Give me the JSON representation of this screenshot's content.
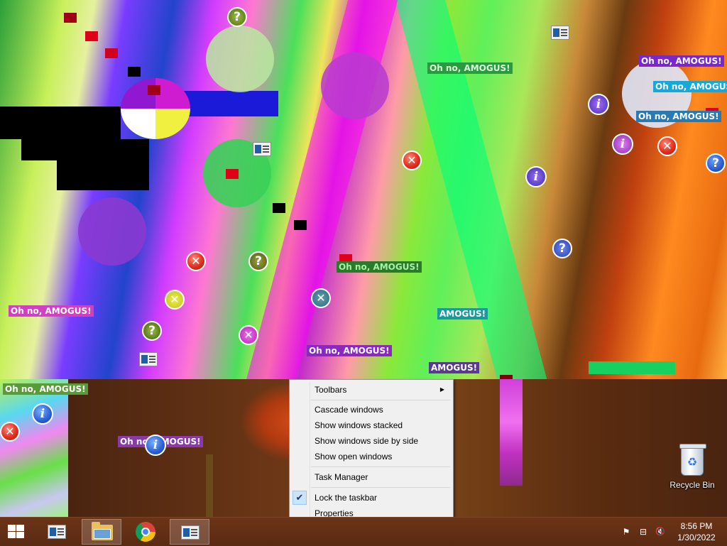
{
  "desktop": {
    "glitch_labels": [
      "Oh no, AMOGUS!",
      "Oh no, AMOGUS!",
      "Oh no, AMOGUS!",
      "Oh no, AMOGUS!",
      "Oh no, AMOGUS!",
      "Oh no, AMOGUS!",
      "Oh no, AMOGUS!",
      "AMOGUS!",
      "AMOGUS!",
      "Oh no, AMOGUS!",
      "Oh no, AMOGUS!",
      "Oh no, AMOGUS!"
    ],
    "recycle_bin_label": "Recycle Bin",
    "icons": [
      "error-icon",
      "info-icon",
      "question-icon",
      "window-icon"
    ]
  },
  "context_menu": {
    "toolbars": "Toolbars",
    "submenu_arrow": "▶",
    "cascade": "Cascade windows",
    "stacked": "Show windows stacked",
    "side_by_side": "Show windows side by side",
    "show_open": "Show open windows",
    "task_manager": "Task Manager",
    "lock_taskbar": "Lock the taskbar",
    "lock_checked": true,
    "checkmark": "✔",
    "properties": "Properties"
  },
  "taskbar": {
    "pinned": [
      "window-icon",
      "file-explorer-icon",
      "chrome-icon",
      "window-icon"
    ],
    "tray": {
      "flag_glyph": "⚑",
      "network_glyph": "⊟",
      "volume_glyph": "🔇"
    },
    "clock": {
      "time": "8:56 PM",
      "date": "1/30/2022"
    }
  },
  "colors": {
    "taskbar": "#5a2a12",
    "menu_bg": "#f0f0f0",
    "check_highlight": "#cce4f7",
    "error": "#e03020",
    "info": "#2a60d0"
  }
}
